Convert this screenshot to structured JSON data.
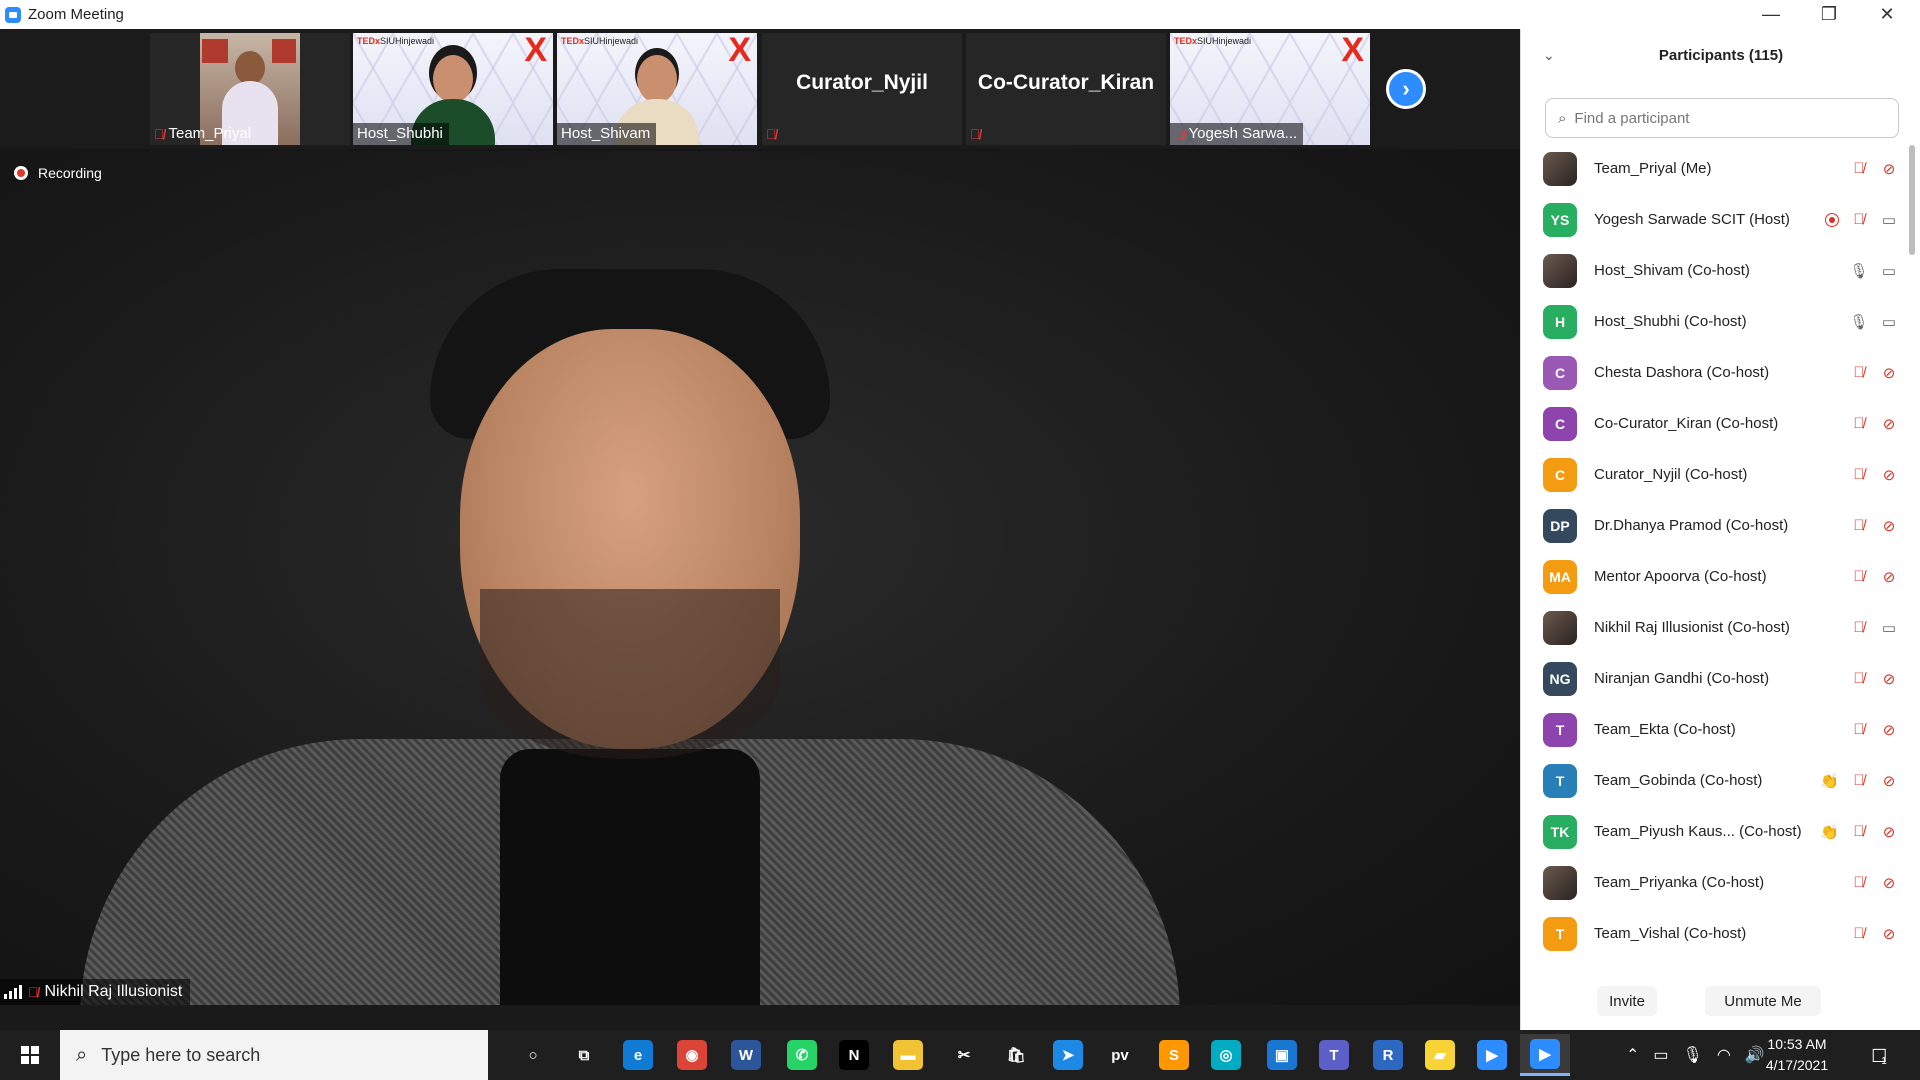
{
  "window": {
    "title": "Zoom Meeting"
  },
  "filmstrip": {
    "tiles": [
      {
        "name": "Team_Priyal",
        "muted": true
      },
      {
        "name": "Host_Shubhi",
        "muted": false
      },
      {
        "name": "Host_Shivam",
        "muted": false
      },
      {
        "name": "Curator_Nyjil",
        "muted": true
      },
      {
        "name": "Co-Curator_Kiran",
        "muted": true
      },
      {
        "name": "Yogesh Sarwa...",
        "muted": true
      }
    ],
    "ted_logo": "TEDx",
    "ted_logo_sub": "SIUHinjewadi",
    "ted_x": "X"
  },
  "main_video": {
    "recording_label": "Recording",
    "speaker_name": "Nikhil Raj Illusionist"
  },
  "participants": {
    "title": "Participants (115)",
    "search_placeholder": "Find a participant",
    "items": [
      {
        "name": "Team_Priyal (Me)",
        "avatar": "",
        "color": "",
        "mic": "off",
        "cam": "off"
      },
      {
        "name": "Yogesh Sarwade SCIT (Host)",
        "avatar": "YS",
        "color": "#27ae60",
        "mic": "off",
        "cam": "on",
        "recording": true
      },
      {
        "name": "Host_Shivam (Co-host)",
        "avatar": "",
        "color": "",
        "mic": "on",
        "cam": "on"
      },
      {
        "name": "Host_Shubhi (Co-host)",
        "avatar": "H",
        "color": "#27ae60",
        "mic": "on",
        "cam": "on"
      },
      {
        "name": "Chesta Dashora (Co-host)",
        "avatar": "C",
        "color": "#9b59b6",
        "mic": "off",
        "cam": "off"
      },
      {
        "name": "Co-Curator_Kiran (Co-host)",
        "avatar": "C",
        "color": "#8e44ad",
        "mic": "off",
        "cam": "off"
      },
      {
        "name": "Curator_Nyjil (Co-host)",
        "avatar": "C",
        "color": "#f39c12",
        "mic": "off",
        "cam": "off"
      },
      {
        "name": "Dr.Dhanya Pramod (Co-host)",
        "avatar": "DP",
        "color": "#34495e",
        "mic": "off",
        "cam": "off"
      },
      {
        "name": "Mentor Apoorva (Co-host)",
        "avatar": "MA",
        "color": "#f39c12",
        "mic": "off",
        "cam": "off"
      },
      {
        "name": "Nikhil Raj Illusionist (Co-host)",
        "avatar": "",
        "color": "",
        "mic": "off",
        "cam": "on"
      },
      {
        "name": "Niranjan Gandhi (Co-host)",
        "avatar": "NG",
        "color": "#34495e",
        "mic": "off",
        "cam": "off"
      },
      {
        "name": "Team_Ekta (Co-host)",
        "avatar": "T",
        "color": "#8e44ad",
        "mic": "off",
        "cam": "off"
      },
      {
        "name": "Team_Gobinda (Co-host)",
        "avatar": "T",
        "color": "#2980b9",
        "mic": "off",
        "cam": "off",
        "clap": true
      },
      {
        "name": "Team_Piyush Kaus...  (Co-host)",
        "avatar": "TK",
        "color": "#27ae60",
        "mic": "off",
        "cam": "off",
        "clap": true
      },
      {
        "name": "Team_Priyanka (Co-host)",
        "avatar": "",
        "color": "",
        "mic": "off",
        "cam": "off"
      },
      {
        "name": "Team_Vishal (Co-host)",
        "avatar": "T",
        "color": "#f39c12",
        "mic": "off",
        "cam": "off"
      }
    ],
    "invite_label": "Invite",
    "unmute_label": "Unmute Me"
  },
  "taskbar": {
    "search_placeholder": "Type here to search",
    "apps": [
      {
        "name": "cortana-icon",
        "glyph": "○",
        "color": "transparent"
      },
      {
        "name": "task-view-icon",
        "glyph": "⧉",
        "color": "transparent"
      },
      {
        "name": "edge-icon",
        "glyph": "e",
        "color": "#0f7bd4"
      },
      {
        "name": "chrome-icon",
        "glyph": "◉",
        "color": "#db4437"
      },
      {
        "name": "word-icon",
        "glyph": "W",
        "color": "#2b579a"
      },
      {
        "name": "whatsapp-icon",
        "glyph": "✆",
        "color": "#25d366"
      },
      {
        "name": "netflix-icon",
        "glyph": "N",
        "color": "#000000"
      },
      {
        "name": "file-explorer-icon",
        "glyph": "▬",
        "color": "#f1c232"
      },
      {
        "name": "snipping-tool-icon",
        "glyph": "✂",
        "color": "transparent"
      },
      {
        "name": "store-icon",
        "glyph": "🛍",
        "color": "transparent"
      },
      {
        "name": "safari-like-icon",
        "glyph": "➤",
        "color": "#1e88e5"
      },
      {
        "name": "prime-video-icon",
        "glyph": "pv",
        "color": "transparent"
      },
      {
        "name": "sublime-icon",
        "glyph": "S",
        "color": "#ff9800"
      },
      {
        "name": "instagram-icon",
        "glyph": "◎",
        "color": "#00acc1"
      },
      {
        "name": "photos-icon",
        "glyph": "▣",
        "color": "#1976d2"
      },
      {
        "name": "teams-icon",
        "glyph": "T",
        "color": "#5b5fc7"
      },
      {
        "name": "r-icon",
        "glyph": "R",
        "color": "#2c68c2"
      },
      {
        "name": "sticky-notes-icon",
        "glyph": "▰",
        "color": "#f7d335"
      },
      {
        "name": "zoom-icon",
        "glyph": "▶",
        "color": "#2d8cff"
      },
      {
        "name": "zoom-meeting-icon",
        "glyph": "▶",
        "color": "#2d8cff"
      }
    ],
    "time": "10:53 AM",
    "date": "4/17/2021",
    "notification_count": "1"
  }
}
